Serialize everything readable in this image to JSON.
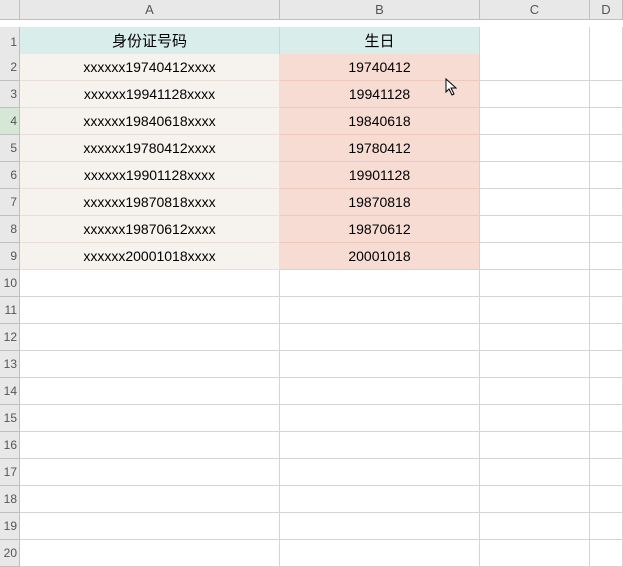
{
  "columns": {
    "A": "A",
    "B": "B",
    "C": "C",
    "D": "D"
  },
  "table_headers": {
    "id": "身份证号码",
    "birthday": "生日"
  },
  "rows": [
    {
      "n": "2",
      "id": "xxxxxx19740412xxxx",
      "birthday": "19740412"
    },
    {
      "n": "3",
      "id": "xxxxxx19941128xxxx",
      "birthday": "19941128"
    },
    {
      "n": "4",
      "id": "xxxxxx19840618xxxx",
      "birthday": "19840618"
    },
    {
      "n": "5",
      "id": "xxxxxx19780412xxxx",
      "birthday": "19780412"
    },
    {
      "n": "6",
      "id": "xxxxxx19901128xxxx",
      "birthday": "19901128"
    },
    {
      "n": "7",
      "id": "xxxxxx19870818xxxx",
      "birthday": "19870818"
    },
    {
      "n": "8",
      "id": "xxxxxx19870612xxxx",
      "birthday": "19870612"
    },
    {
      "n": "9",
      "id": "xxxxxx20001018xxxx",
      "birthday": "20001018"
    }
  ],
  "empty_rows": [
    "10",
    "11",
    "12",
    "13",
    "14",
    "15",
    "16",
    "17",
    "18",
    "19",
    "20"
  ],
  "header_row_num": "1",
  "selected_row": "4"
}
